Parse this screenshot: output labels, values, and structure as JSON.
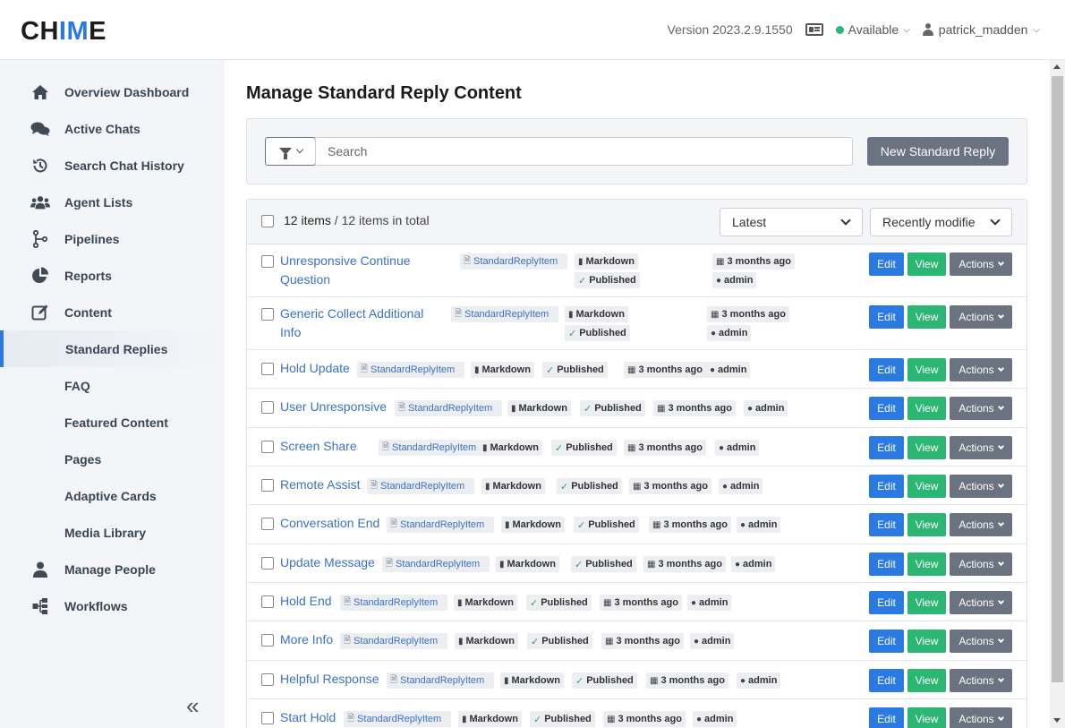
{
  "app": {
    "logo_left": "CH",
    "logo_mid": "IM",
    "logo_right": "E"
  },
  "header": {
    "version": "Version 2023.2.9.1550",
    "status": "Available",
    "username": "patrick_madden",
    "status_color": "#2bb673"
  },
  "sidebar": {
    "items": [
      {
        "label": "Overview Dashboard",
        "icon": "home-icon"
      },
      {
        "label": "Active Chats",
        "icon": "chat-bubbles-icon"
      },
      {
        "label": "Search Chat History",
        "icon": "history-icon"
      },
      {
        "label": "Agent Lists",
        "icon": "users-icon"
      },
      {
        "label": "Pipelines",
        "icon": "pipeline-icon"
      },
      {
        "label": "Reports",
        "icon": "pie-chart-icon"
      },
      {
        "label": "Content",
        "icon": "edit-icon"
      },
      {
        "label": "Standard Replies",
        "icon": ""
      },
      {
        "label": "FAQ",
        "icon": ""
      },
      {
        "label": "Featured Content",
        "icon": ""
      },
      {
        "label": "Pages",
        "icon": ""
      },
      {
        "label": "Adaptive Cards",
        "icon": ""
      },
      {
        "label": "Media Library",
        "icon": ""
      },
      {
        "label": "Manage People",
        "icon": "person-icon"
      },
      {
        "label": "Workflows",
        "icon": "workflow-icon"
      }
    ],
    "collapse_glyph": "«"
  },
  "main": {
    "title": "Manage Standard Reply Content",
    "search_placeholder": "Search",
    "new_button": "New Standard Reply",
    "count": "12 items",
    "total": " / 12 items in total",
    "sort_primary": "Latest",
    "sort_secondary": "Recently modifie",
    "buttons": {
      "edit": "Edit",
      "view": "View",
      "actions": "Actions"
    },
    "rows": [
      {
        "title1": "Unresponsive Continue",
        "title2": "Question",
        "type": "StandardReplyItem",
        "format": "Markdown",
        "state": "Published",
        "age": "3 months ago",
        "author": "admin"
      },
      {
        "title1": "Generic Collect Additional",
        "title2": "Info",
        "type": "StandardReplyItem",
        "format": "Markdown",
        "state": "Published",
        "age": "3 months ago",
        "author": "admin"
      },
      {
        "title1": "Hold Update",
        "title2": "",
        "type": "StandardReplyItem",
        "format": "Markdown",
        "state": "Published",
        "age": "3 months ago",
        "author": "admin"
      },
      {
        "title1": "User Unresponsive",
        "title2": "",
        "type": "StandardReplyItem",
        "format": "Markdown",
        "state": "Published",
        "age": "3 months ago",
        "author": "admin"
      },
      {
        "title1": "Screen Share",
        "title2": "",
        "type": "StandardReplyItem",
        "format": "Markdown",
        "state": "Published",
        "age": "3 months ago",
        "author": "admin"
      },
      {
        "title1": "Remote Assist",
        "title2": "",
        "type": "StandardReplyItem",
        "format": "Markdown",
        "state": "Published",
        "age": "3 months ago",
        "author": "admin"
      },
      {
        "title1": "Conversation End",
        "title2": "",
        "type": "StandardReplyItem",
        "format": "Markdown",
        "state": "Published",
        "age": "3 months ago",
        "author": "admin"
      },
      {
        "title1": "Update Message",
        "title2": "",
        "type": "StandardReplyItem",
        "format": "Markdown",
        "state": "Published",
        "age": "3 months ago",
        "author": "admin"
      },
      {
        "title1": "Hold End",
        "title2": "",
        "type": "StandardReplyItem",
        "format": "Markdown",
        "state": "Published",
        "age": "3 months ago",
        "author": "admin"
      },
      {
        "title1": "More Info",
        "title2": "",
        "type": "StandardReplyItem",
        "format": "Markdown",
        "state": "Published",
        "age": "3 months ago",
        "author": "admin"
      },
      {
        "title1": "Helpful Response",
        "title2": "",
        "type": "StandardReplyItem",
        "format": "Markdown",
        "state": "Published",
        "age": "3 months ago",
        "author": "admin"
      },
      {
        "title1": "Start Hold",
        "title2": "",
        "type": "StandardReplyItem",
        "format": "Markdown",
        "state": "Published",
        "age": "3 months ago",
        "author": "admin"
      }
    ]
  },
  "colors": {
    "accent": "#2a7ae2",
    "success": "#2bb673",
    "neutral": "#6b7280"
  }
}
